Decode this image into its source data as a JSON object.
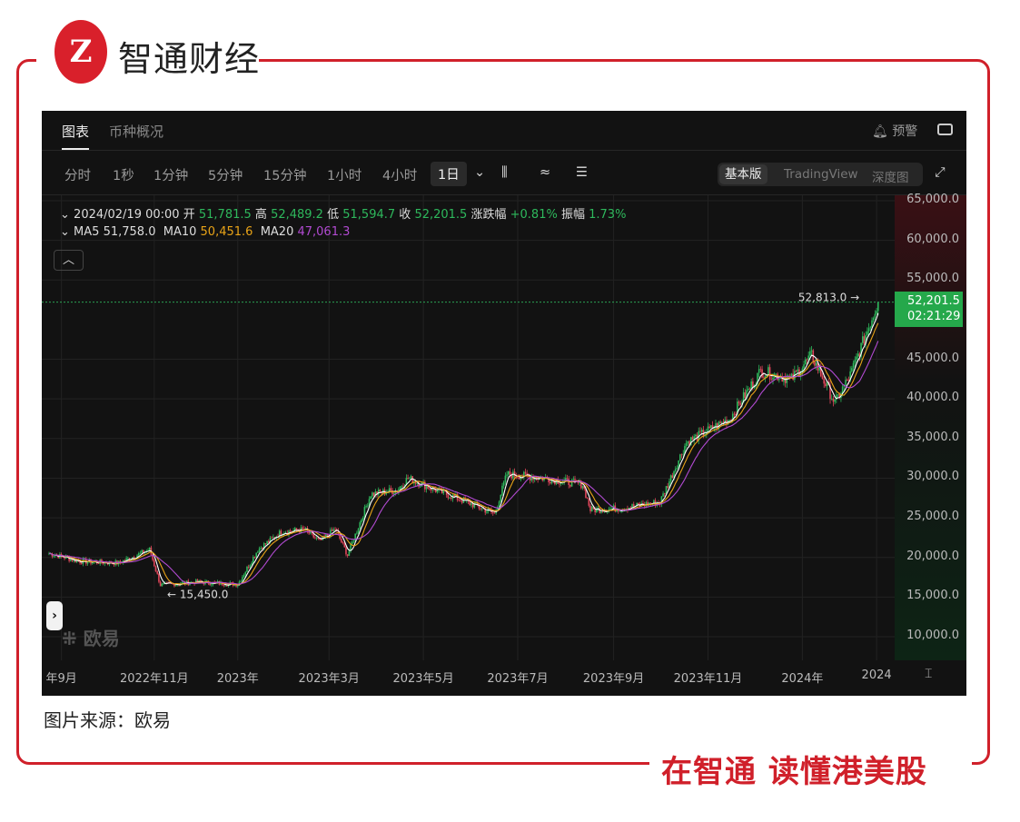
{
  "brand": {
    "logo_text": "Z",
    "name": "智通财经",
    "slogan": "在智通  读懂港美股"
  },
  "caption": "图片来源：欧易",
  "tabs": [
    {
      "label": "图表",
      "active": true
    },
    {
      "label": "币种概况"
    }
  ],
  "alert": {
    "label": "预警"
  },
  "timeframes": [
    "分时",
    "1秒",
    "1分钟",
    "5分钟",
    "15分钟",
    "1小时",
    "4小时"
  ],
  "timeframe_selected": "1日",
  "views": [
    "基本版",
    "TradingView",
    "深度图"
  ],
  "ohlc": {
    "date": "2024/02/19 00:00",
    "open_label": "开",
    "open": "51,781.5",
    "high_label": "高",
    "high": "52,489.2",
    "low_label": "低",
    "low": "51,594.7",
    "close_label": "收",
    "close": "52,201.5",
    "change_label": "涨跌幅",
    "change": "+0.81%",
    "amp_label": "振幅",
    "amp": "1.73%"
  },
  "ma": {
    "ma5_label": "MA5",
    "ma5": "51,758.0",
    "ma10_label": "MA10",
    "ma10": "50,451.6",
    "ma20_label": "MA20",
    "ma20": "47,061.3"
  },
  "colors": {
    "up": "#2eb85c",
    "down": "#e0455a",
    "ma5": "#ffffff",
    "ma10": "#e8a317",
    "ma20": "#b14ad1",
    "brand": "#d0202a"
  },
  "watermark": "欧易",
  "price_tag": {
    "price": "52,201.5",
    "countdown": "02:21:29"
  },
  "chart_data": {
    "type": "candlestick",
    "ylim": [
      8000,
      66000
    ],
    "y_ticks": [
      "65,000.0",
      "60,000.0",
      "55,000.0",
      "45,000.0",
      "40,000.0",
      "35,000.0",
      "30,000.0",
      "25,000.0",
      "20,000.0",
      "15,000.0",
      "10,000.0"
    ],
    "y_tick_values": [
      65000,
      60000,
      55000,
      45000,
      40000,
      35000,
      30000,
      25000,
      20000,
      15000,
      10000
    ],
    "x_labels": [
      "年9月",
      "2022年11月",
      "2023年",
      "2023年3月",
      "2023年5月",
      "2023年7月",
      "2023年9月",
      "2023年11月",
      "2024年",
      "2024"
    ],
    "x_label_days": [
      8,
      68,
      122,
      181,
      242,
      303,
      365,
      426,
      487,
      535
    ],
    "start_date": "2022-09-01",
    "end_date": "2024-02-19",
    "close_keypoints": [
      [
        0,
        20500
      ],
      [
        20,
        19500
      ],
      [
        45,
        19300
      ],
      [
        65,
        21000
      ],
      [
        72,
        16500
      ],
      [
        95,
        16900
      ],
      [
        122,
        16600
      ],
      [
        135,
        21000
      ],
      [
        150,
        23200
      ],
      [
        165,
        23500
      ],
      [
        175,
        22000
      ],
      [
        185,
        23600
      ],
      [
        193,
        20300
      ],
      [
        208,
        28000
      ],
      [
        225,
        28500
      ],
      [
        232,
        30000
      ],
      [
        250,
        28500
      ],
      [
        270,
        27000
      ],
      [
        288,
        25500
      ],
      [
        296,
        30500
      ],
      [
        320,
        30000
      ],
      [
        345,
        29200
      ],
      [
        350,
        26000
      ],
      [
        370,
        26200
      ],
      [
        395,
        27000
      ],
      [
        412,
        34500
      ],
      [
        440,
        37500
      ],
      [
        460,
        43500
      ],
      [
        480,
        42500
      ],
      [
        493,
        45500
      ],
      [
        508,
        39500
      ],
      [
        518,
        43000
      ],
      [
        536,
        52201.5
      ]
    ],
    "annotations": [
      {
        "text": "52,813.0 →",
        "value": 52813
      },
      {
        "text": "← 15,450.0",
        "value": 15450
      }
    ],
    "last_price": 52201.5
  }
}
